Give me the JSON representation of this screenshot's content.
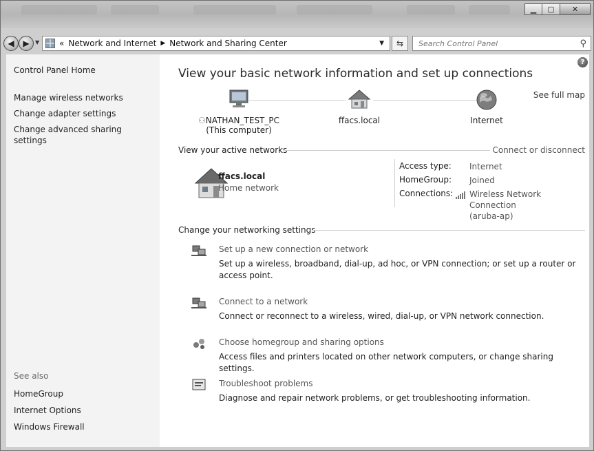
{
  "search": {
    "placeholder": "Search Control Panel"
  },
  "breadcrumb": {
    "overflow": "«",
    "segments": [
      "Network and Internet",
      "Network and Sharing Center"
    ]
  },
  "sidebar": {
    "home": "Control Panel Home",
    "links": [
      "Manage wireless networks",
      "Change adapter settings",
      "Change advanced sharing",
      "settings"
    ],
    "see_also_label": "See also",
    "see_also": [
      "HomeGroup",
      "Internet Options",
      "Windows Firewall"
    ]
  },
  "main": {
    "heading": "View your basic network information and set up connections",
    "see_full_map": "See full map",
    "map": {
      "computer": "NATHAN_TEST_PC",
      "computer_sub": "(This computer)",
      "network": "ffacs.local",
      "internet": "Internet"
    },
    "active": {
      "header": "View your active networks",
      "connect_link": "Connect or disconnect",
      "name": "ffacs.local",
      "type": "Home network",
      "labels": [
        "Access type:",
        "HomeGroup:",
        "Connections:"
      ],
      "access_type": "Internet",
      "homegroup": "Joined",
      "connection_line1": "Wireless Network Connection",
      "connection_line2": "(aruba-ap)"
    },
    "change_header": "Change your networking settings",
    "tasks": [
      {
        "title": "Set up a new connection or network",
        "desc": "Set up a wireless, broadband, dial-up, ad hoc, or VPN connection; or set up a router or access point."
      },
      {
        "title": "Connect to a network",
        "desc": "Connect or reconnect to a wireless, wired, dial-up, or VPN network connection."
      },
      {
        "title": "Choose homegroup and sharing options",
        "desc": "Access files and printers located on other network computers, or change sharing settings."
      },
      {
        "title": "Troubleshoot problems",
        "desc": "Diagnose and repair network problems, or get troubleshooting information."
      }
    ]
  },
  "icons": [
    "back-arrow-icon",
    "forward-arrow-icon",
    "control-panel-icon",
    "refresh-icon",
    "search-icon",
    "help-icon",
    "computer-icon",
    "house-icon",
    "globe-icon",
    "network-setup-icon",
    "homegroup-icon",
    "troubleshoot-icon",
    "signal-bars-icon"
  ]
}
